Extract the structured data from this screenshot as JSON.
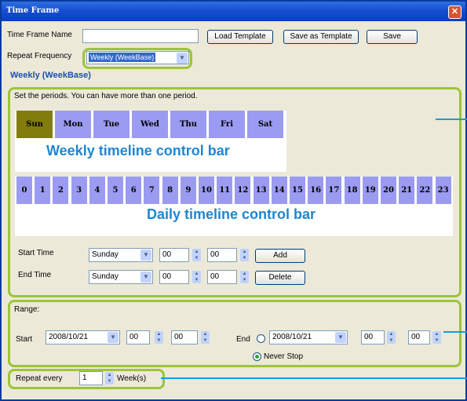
{
  "window": {
    "title": "Time Frame",
    "close_glyph": "✕"
  },
  "form": {
    "name_label": "Time Frame Name",
    "name_value": "",
    "load_template": "Load Template",
    "save_as_template": "Save as Template",
    "save": "Save",
    "repeat_freq_label": "Repeat Frequency",
    "repeat_freq_value": "Weekly (WeekBase)"
  },
  "weekly": {
    "section_title": "Weekly (WeekBase)",
    "instruction": "Set the periods. You can have more than one period.",
    "days": [
      "Sun",
      "Mon",
      "Tue",
      "Wed",
      "Thu",
      "Fri",
      "Sat"
    ],
    "active_day": "Sun",
    "hours": [
      "0",
      "1",
      "2",
      "3",
      "4",
      "5",
      "6",
      "7",
      "8",
      "9",
      "10",
      "11",
      "12",
      "13",
      "14",
      "15",
      "16",
      "17",
      "18",
      "19",
      "20",
      "21",
      "22",
      "23"
    ],
    "weekly_bar_label": "Weekly timeline control bar",
    "daily_bar_label": "Daily timeline control bar",
    "start_time_label": "Start Time",
    "start_day": "Sunday",
    "start_hour": "00",
    "start_min": "00",
    "add": "Add",
    "end_time_label": "End Time",
    "end_day": "Sunday",
    "end_hour": "00",
    "end_min": "00",
    "delete": "Delete"
  },
  "range": {
    "label": "Range:",
    "start_label": "Start",
    "start_date": "2008/10/21",
    "start_hour": "00",
    "start_min": "00",
    "end_label": "End",
    "end_date": "2008/10/21",
    "end_hour": "00",
    "end_min": "00",
    "never_stop": "Never Stop"
  },
  "repeat": {
    "label": "Repeat every",
    "value": "1",
    "unit": "Week(s)"
  },
  "colors": {
    "accent_green": "#9dc43a",
    "day_bar": "#9b9bf2",
    "active_day": "#827c0d",
    "annotation": "#1f86cf"
  }
}
